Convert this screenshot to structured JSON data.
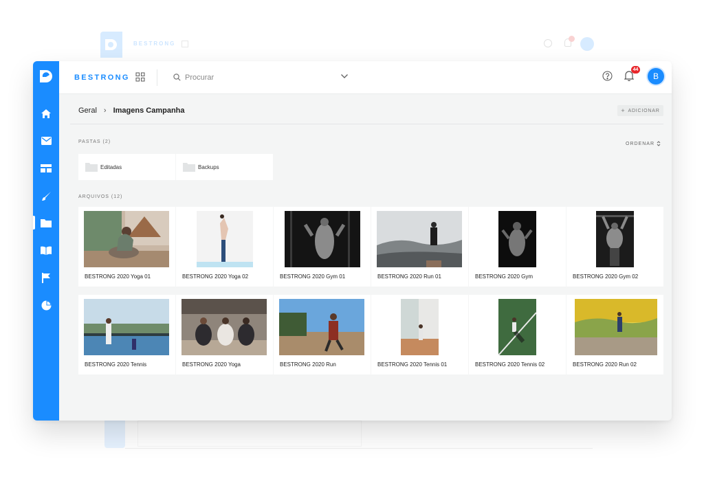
{
  "app": {
    "brand": "BESTRONG",
    "brand_color": "#1a8cff"
  },
  "sidebar": {
    "items": [
      {
        "icon": "home-icon",
        "active": false
      },
      {
        "icon": "mail-icon",
        "active": false
      },
      {
        "icon": "layout-icon",
        "active": false
      },
      {
        "icon": "brush-icon",
        "active": false
      },
      {
        "icon": "folder-icon",
        "active": true
      },
      {
        "icon": "book-icon",
        "active": false
      },
      {
        "icon": "flag-icon",
        "active": false
      },
      {
        "icon": "pie-chart-icon",
        "active": false
      }
    ]
  },
  "header": {
    "search_placeholder": "Procurar",
    "notifications_count": "44",
    "avatar_initial": "B"
  },
  "breadcrumb": {
    "root": "Geral",
    "separator": "›",
    "current": "Imagens Campanha"
  },
  "actions": {
    "add_label": "ADICIONAR",
    "sort_label": "ORDENAR"
  },
  "folders": {
    "label": "PASTAS (2)",
    "items": [
      {
        "name": "Editadas"
      },
      {
        "name": "Backups"
      }
    ]
  },
  "files": {
    "label": "ARQUIVOS (12)",
    "items": [
      {
        "name": "BESTRONG 2020 Yoga 01"
      },
      {
        "name": "BESTRONG 2020 Yoga 02"
      },
      {
        "name": "BESTRONG 2020 Gym 01"
      },
      {
        "name": "BESTRONG 2020 Run 01"
      },
      {
        "name": "BESTRONG 2020 Gym"
      },
      {
        "name": "BESTRONG 2020 Gym 02"
      },
      {
        "name": "BESTRONG 2020 Tennis"
      },
      {
        "name": "BESTRONG 2020 Yoga"
      },
      {
        "name": "BESTRONG 2020 Run"
      },
      {
        "name": "BESTRONG 2020 Tennis 01"
      },
      {
        "name": "BESTRONG 2020 Tennis 02"
      },
      {
        "name": "BESTRONG 2020 Run 02"
      }
    ]
  }
}
